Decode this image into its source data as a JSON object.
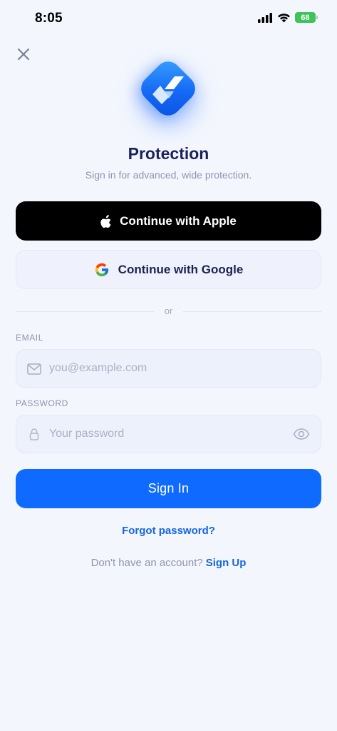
{
  "status_bar": {
    "time": "8:05",
    "battery": "68"
  },
  "header": {
    "app_name": "Protection",
    "subtitle": "Sign in for advanced, wide protection."
  },
  "social": {
    "apple_label": "Continue with Apple",
    "google_label": "Continue with Google"
  },
  "divider_text": "or",
  "email": {
    "label": "EMAIL",
    "placeholder": "you@example.com",
    "value": ""
  },
  "password": {
    "label": "PASSWORD",
    "placeholder": "Your password",
    "value": ""
  },
  "sign_in_label": "Sign In",
  "forgot_label": "Forgot password?",
  "signup": {
    "prompt": "Don't have an account?",
    "link": "Sign Up"
  },
  "colors": {
    "accent": "#0F6BFF",
    "link": "#1466E0",
    "background": "#F3F6FD",
    "title": "#1B2257"
  },
  "icons": [
    "close-icon",
    "cellular-signal-icon",
    "wifi-icon",
    "battery-icon",
    "app-logo",
    "apple-icon",
    "google-icon",
    "mail-icon",
    "lock-icon",
    "eye-icon"
  ]
}
